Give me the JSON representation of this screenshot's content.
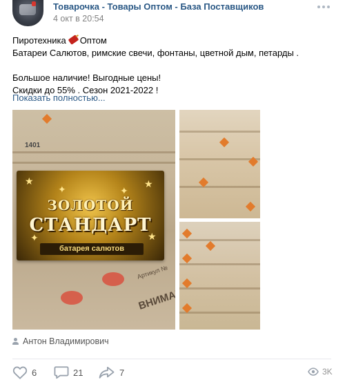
{
  "post": {
    "group_name": "Товарочка - Товары Оптом - База Поставщиков",
    "date": "4 окт в 20:54",
    "text_line1_a": "Пиротехника",
    "text_line1_b": "Оптом",
    "text_line2": "Батареи Салютов, римские свечи, фонтаны, цветной дым, петарды .",
    "text_line3": "Большое наличие! Выгодные цены!",
    "text_line4": "Скидки до 55% . Сезон 2021-2022 !",
    "show_more": "Показать полностью...",
    "author": "Антон Владимирович"
  },
  "photo_main": {
    "box_label": "1401",
    "banner_title1": "ЗОЛОТОЙ",
    "banner_title2": "СТАНДАРТ",
    "banner_subtitle": "батарея салютов",
    "box_artikul": "Артикул №",
    "box_warning": "ВНИМАНИЕ НЕ ПР"
  },
  "actions": {
    "likes": "6",
    "comments": "21",
    "shares": "7",
    "views": "3K"
  },
  "colors": {
    "link": "#2a5885",
    "meta": "#828282",
    "icon": "#99a2ad"
  },
  "icons": {
    "more": "more-dots-icon",
    "like": "heart-icon",
    "comment": "comment-icon",
    "share": "share-arrow-icon",
    "views": "eye-icon",
    "author": "person-icon",
    "emoji": "firecracker-emoji"
  }
}
